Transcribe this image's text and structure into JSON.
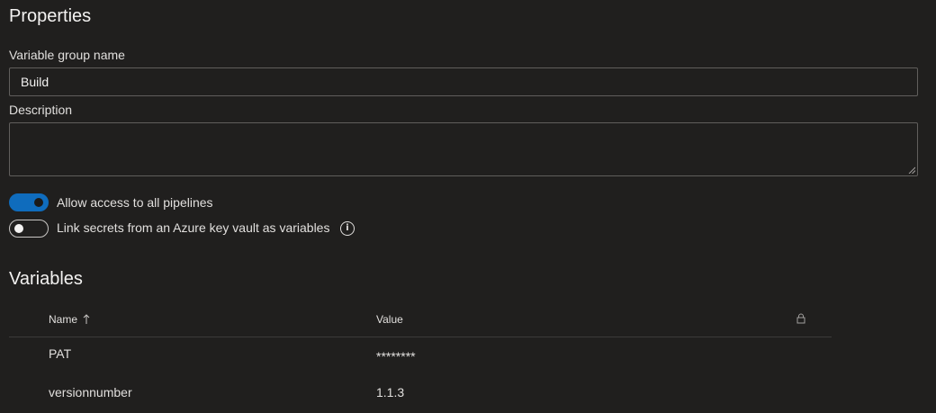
{
  "properties": {
    "title": "Properties",
    "group_name_label": "Variable group name",
    "group_name_value": "Build",
    "description_label": "Description",
    "description_value": ""
  },
  "toggles": [
    {
      "label": "Allow access to all pipelines",
      "on": true
    },
    {
      "label": "Link secrets from an Azure key vault as variables",
      "on": false
    }
  ],
  "variables": {
    "title": "Variables",
    "columns": {
      "name": "Name",
      "name_sort_icon": "arrow-up-icon",
      "value": "Value",
      "lock_icon": "lock-icon"
    },
    "rows": [
      {
        "name": "PAT",
        "value": "********"
      },
      {
        "name": "versionnumber",
        "value": "1.1.3"
      }
    ]
  },
  "colors": {
    "background": "#201f1e",
    "toggle_on": "#0f6cbd",
    "input_border": "#605e5c"
  }
}
